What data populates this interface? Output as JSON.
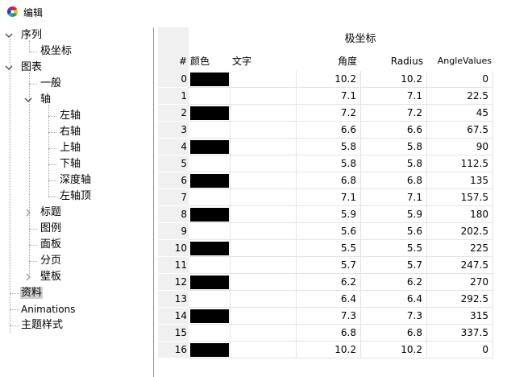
{
  "window": {
    "title": "编辑"
  },
  "tree": {
    "items": [
      {
        "label": "序列"
      },
      {
        "label": "极坐标"
      },
      {
        "label": "图表"
      },
      {
        "label": "一般"
      },
      {
        "label": "轴"
      },
      {
        "label": "左轴"
      },
      {
        "label": "右轴"
      },
      {
        "label": "上轴"
      },
      {
        "label": "下轴"
      },
      {
        "label": "深度轴"
      },
      {
        "label": "左轴顶"
      },
      {
        "label": "标题"
      },
      {
        "label": "图例"
      },
      {
        "label": "面板"
      },
      {
        "label": "分页"
      },
      {
        "label": "壁板"
      },
      {
        "label": "资料"
      },
      {
        "label": "Animations"
      },
      {
        "label": "主题样式"
      }
    ]
  },
  "grid": {
    "caption": "极坐标",
    "headers": {
      "index": "#",
      "color": "颜色",
      "text": "文字",
      "angle": "角度",
      "radius": "Radius",
      "angle_values": "AngleValues"
    },
    "rows": [
      {
        "idx": "0",
        "text": "",
        "angle": "10.2",
        "radius": "10.2",
        "angle_values": "0",
        "color": "#000000"
      },
      {
        "idx": "1",
        "text": "",
        "angle": "7.1",
        "radius": "7.1",
        "angle_values": "22.5",
        "color": ""
      },
      {
        "idx": "2",
        "text": "",
        "angle": "7.2",
        "radius": "7.2",
        "angle_values": "45",
        "color": "#000000"
      },
      {
        "idx": "3",
        "text": "",
        "angle": "6.6",
        "radius": "6.6",
        "angle_values": "67.5",
        "color": ""
      },
      {
        "idx": "4",
        "text": "",
        "angle": "5.8",
        "radius": "5.8",
        "angle_values": "90",
        "color": "#000000"
      },
      {
        "idx": "5",
        "text": "",
        "angle": "5.8",
        "radius": "5.8",
        "angle_values": "112.5",
        "color": ""
      },
      {
        "idx": "6",
        "text": "",
        "angle": "6.8",
        "radius": "6.8",
        "angle_values": "135",
        "color": "#000000"
      },
      {
        "idx": "7",
        "text": "",
        "angle": "7.1",
        "radius": "7.1",
        "angle_values": "157.5",
        "color": ""
      },
      {
        "idx": "8",
        "text": "",
        "angle": "5.9",
        "radius": "5.9",
        "angle_values": "180",
        "color": "#000000"
      },
      {
        "idx": "9",
        "text": "",
        "angle": "5.6",
        "radius": "5.6",
        "angle_values": "202.5",
        "color": ""
      },
      {
        "idx": "10",
        "text": "",
        "angle": "5.5",
        "radius": "5.5",
        "angle_values": "225",
        "color": "#000000"
      },
      {
        "idx": "11",
        "text": "",
        "angle": "5.7",
        "radius": "5.7",
        "angle_values": "247.5",
        "color": ""
      },
      {
        "idx": "12",
        "text": "",
        "angle": "6.2",
        "radius": "6.2",
        "angle_values": "270",
        "color": "#000000"
      },
      {
        "idx": "13",
        "text": "",
        "angle": "6.4",
        "radius": "6.4",
        "angle_values": "292.5",
        "color": ""
      },
      {
        "idx": "14",
        "text": "",
        "angle": "7.3",
        "radius": "7.3",
        "angle_values": "315",
        "color": "#000000"
      },
      {
        "idx": "15",
        "text": "",
        "angle": "6.8",
        "radius": "6.8",
        "angle_values": "337.5",
        "color": ""
      },
      {
        "idx": "16",
        "text": "",
        "angle": "10.2",
        "radius": "10.2",
        "angle_values": "0",
        "color": "#000000"
      }
    ]
  },
  "colors": {
    "selection": "#cfcfcf",
    "header_bg": "#f0f0f0",
    "gridline": "#e3e3e3",
    "divider": "#9a9a9a"
  }
}
